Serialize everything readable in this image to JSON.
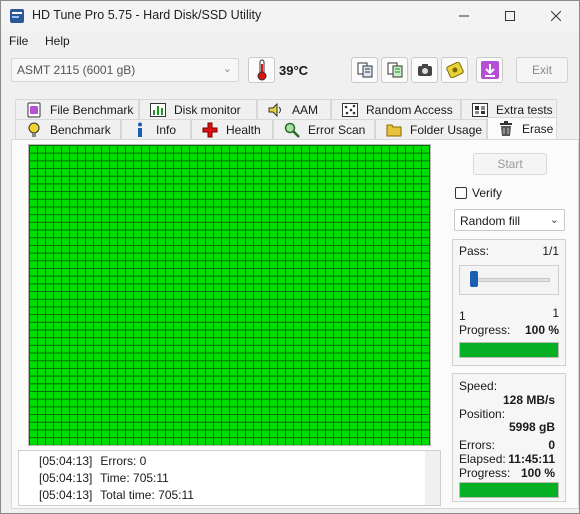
{
  "window": {
    "title": "HD Tune Pro 5.75 - Hard Disk/SSD Utility"
  },
  "menu": {
    "file": "File",
    "help": "Help"
  },
  "toolbar": {
    "drive": "ASMT    2115 (6001 gB)",
    "temperature": "39°C",
    "exit_label": "Exit"
  },
  "tabs": {
    "row1": [
      "File Benchmark",
      "Disk monitor",
      "AAM",
      "Random Access",
      "Extra tests"
    ],
    "row2": [
      "Benchmark",
      "Info",
      "Health",
      "Error Scan",
      "Folder Usage",
      "Erase"
    ]
  },
  "erase": {
    "start_label": "Start",
    "verify_label": "Verify",
    "verify_checked": false,
    "fill_mode": "Random fill",
    "pass": {
      "label": "Pass:",
      "value": "1/1",
      "min": "1",
      "max": "1",
      "progress_label": "Progress:",
      "progress_text": "100 %",
      "progress_fraction": 1.0
    },
    "stats": {
      "speed_label": "Speed:",
      "speed": "128 MB/s",
      "position_label": "Position:",
      "position": "5998 gB",
      "errors_label": "Errors:",
      "errors": "0",
      "elapsed_label": "Elapsed:",
      "elapsed": "11:45:11",
      "progress_label": "Progress:",
      "progress_text": "100 %",
      "progress_fraction": 1.0
    },
    "block_map_state": "all-ok",
    "log": [
      {
        "time": "[05:04:13]",
        "message": "Errors: 0"
      },
      {
        "time": "[05:04:13]",
        "message": "Time: 705:11"
      },
      {
        "time": "[05:04:13]",
        "message": "Total time: 705:11"
      }
    ]
  },
  "colors": {
    "ok_block": "#00dd00",
    "progress": "#06b025",
    "accent": "#1a5fb4"
  }
}
